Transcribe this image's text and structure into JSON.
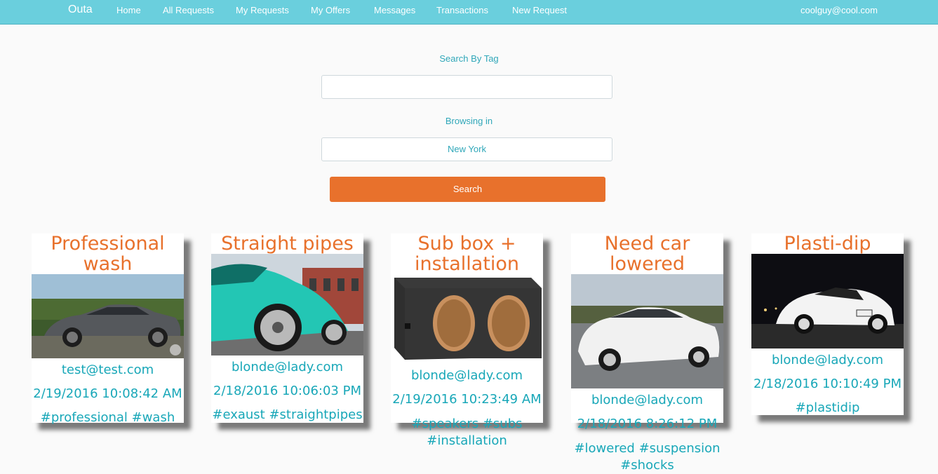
{
  "nav": {
    "brand": "Outa",
    "items": [
      "Home",
      "All Requests",
      "My Requests",
      "My Offers",
      "Messages",
      "Transactions",
      "New Request"
    ],
    "user": "coolguy@cool.com"
  },
  "search": {
    "tag_label": "Search By Tag",
    "tag_value": "",
    "location_label": "Browsing in",
    "location_value": "New York",
    "button_label": "Search"
  },
  "cards": [
    {
      "title": "Professional wash",
      "image": "car-grey-sedan",
      "user": "test@test.com",
      "date": "2/19/2016 10:08:42 AM",
      "tags": "#professional #wash"
    },
    {
      "title": "Straight pipes",
      "image": "car-teal-porsche",
      "user": "blonde@lady.com",
      "date": "2/18/2016 10:06:03 PM",
      "tags": "#exaust #straightpipes"
    },
    {
      "title": "Sub box + installation",
      "image": "subwoofer-box",
      "user": "blonde@lady.com",
      "date": "2/19/2016 10:23:49 AM",
      "tags": "#speakers #subs #installation"
    },
    {
      "title": "Need car lowered",
      "image": "car-white-3000gt",
      "user": "blonde@lady.com",
      "date": "2/18/2016 8:26:12 PM",
      "tags": "#lowered #suspension #shocks"
    },
    {
      "title": "Plasti-dip",
      "image": "car-white-350z",
      "user": "blonde@lady.com",
      "date": "2/18/2016 10:10:49 PM",
      "tags": "#plastidip"
    }
  ],
  "colors": {
    "nav": "#6acfdd",
    "accent": "#e8712c",
    "link": "#18a7b8"
  }
}
